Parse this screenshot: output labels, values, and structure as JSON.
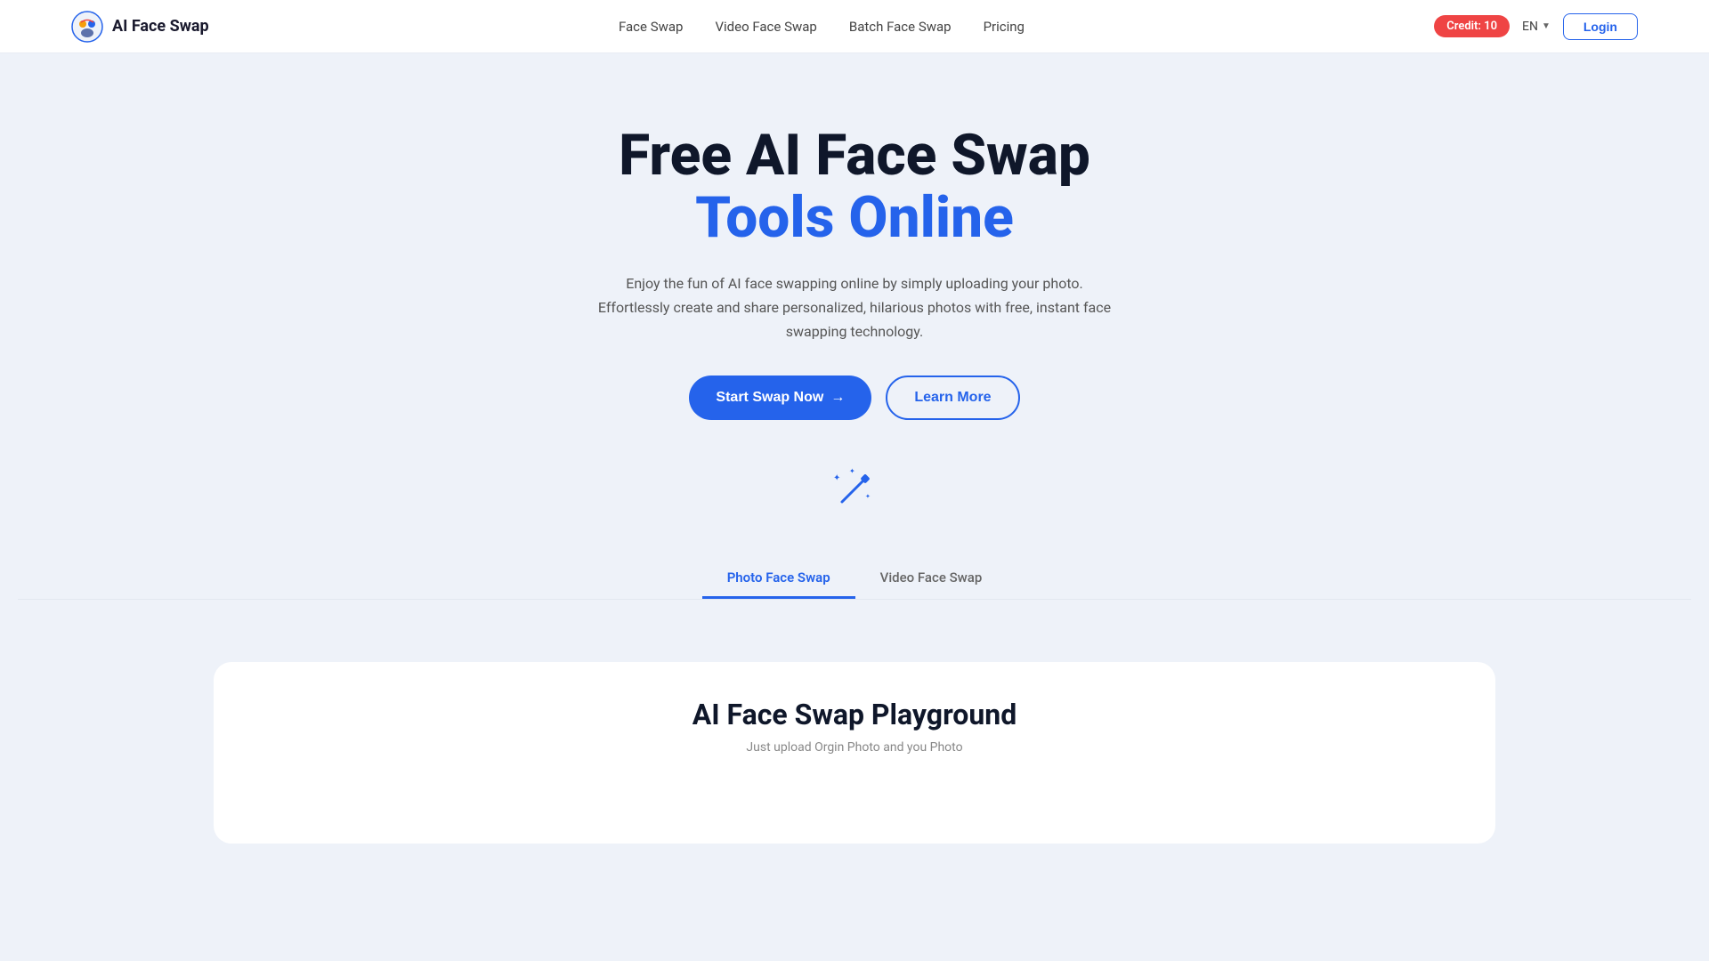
{
  "brand": {
    "name": "AI Face Swap",
    "logo_alt": "AI Face Swap logo"
  },
  "nav": {
    "links": [
      {
        "id": "face-swap",
        "label": "Face Swap"
      },
      {
        "id": "video-face-swap",
        "label": "Video Face Swap"
      },
      {
        "id": "batch-face-swap",
        "label": "Batch Face Swap"
      },
      {
        "id": "pricing",
        "label": "Pricing"
      }
    ],
    "credit_label": "Credit: 10",
    "lang_label": "EN",
    "login_label": "Login"
  },
  "hero": {
    "title_line1": "Free AI Face Swap",
    "title_line2": "Tools Online",
    "description": "Enjoy the fun of AI face swapping online by simply uploading your photo. Effortlessly create and share personalized, hilarious photos with free, instant face swapping technology.",
    "cta_primary": "Start Swap Now",
    "cta_secondary": "Learn More",
    "arrow": "→"
  },
  "tabs": [
    {
      "id": "photo-face-swap",
      "label": "Photo Face Swap",
      "active": true
    },
    {
      "id": "video-face-swap",
      "label": "Video Face Swap",
      "active": false
    }
  ],
  "playground": {
    "title": "AI Face Swap Playground",
    "subtitle": "Just upload Orgin Photo and you Photo"
  },
  "colors": {
    "primary": "#2563eb",
    "heading_dark": "#0f172a",
    "credit_red": "#ef4444"
  }
}
